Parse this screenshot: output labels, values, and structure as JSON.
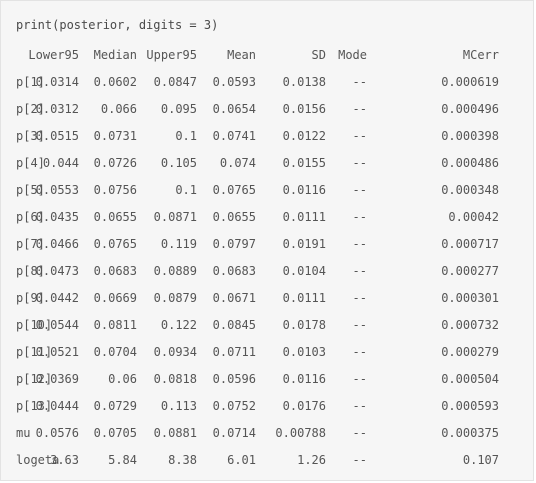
{
  "code": "print(posterior, digits = 3)",
  "columns": [
    "",
    "Lower95",
    "Median",
    "Upper95",
    "Mean",
    "SD",
    "Mode",
    "MCerr"
  ],
  "rows": [
    [
      "p[1]",
      "0.0314",
      "0.0602",
      "0.0847",
      "0.0593",
      "0.0138",
      "--",
      "0.000619"
    ],
    [
      "p[2]",
      "0.0312",
      "0.066",
      "0.095",
      "0.0654",
      "0.0156",
      "--",
      "0.000496"
    ],
    [
      "p[3]",
      "0.0515",
      "0.0731",
      "0.1",
      "0.0741",
      "0.0122",
      "--",
      "0.000398"
    ],
    [
      "p[4]",
      "0.044",
      "0.0726",
      "0.105",
      "0.074",
      "0.0155",
      "--",
      "0.000486"
    ],
    [
      "p[5]",
      "0.0553",
      "0.0756",
      "0.1",
      "0.0765",
      "0.0116",
      "--",
      "0.000348"
    ],
    [
      "p[6]",
      "0.0435",
      "0.0655",
      "0.0871",
      "0.0655",
      "0.0111",
      "--",
      "0.00042"
    ],
    [
      "p[7]",
      "0.0466",
      "0.0765",
      "0.119",
      "0.0797",
      "0.0191",
      "--",
      "0.000717"
    ],
    [
      "p[8]",
      "0.0473",
      "0.0683",
      "0.0889",
      "0.0683",
      "0.0104",
      "--",
      "0.000277"
    ],
    [
      "p[9]",
      "0.0442",
      "0.0669",
      "0.0879",
      "0.0671",
      "0.0111",
      "--",
      "0.000301"
    ],
    [
      "p[10]",
      "0.0544",
      "0.0811",
      "0.122",
      "0.0845",
      "0.0178",
      "--",
      "0.000732"
    ],
    [
      "p[11]",
      "0.0521",
      "0.0704",
      "0.0934",
      "0.0711",
      "0.0103",
      "--",
      "0.000279"
    ],
    [
      "p[12]",
      "0.0369",
      "0.06",
      "0.0818",
      "0.0596",
      "0.0116",
      "--",
      "0.000504"
    ],
    [
      "p[13]",
      "0.0444",
      "0.0729",
      "0.113",
      "0.0752",
      "0.0176",
      "--",
      "0.000593"
    ],
    [
      "mu",
      "0.0576",
      "0.0705",
      "0.0881",
      "0.0714",
      "0.00788",
      "--",
      "0.000375"
    ],
    [
      "logeta",
      "3.63",
      "5.84",
      "8.38",
      "6.01",
      "1.26",
      "--",
      "0.107"
    ]
  ]
}
